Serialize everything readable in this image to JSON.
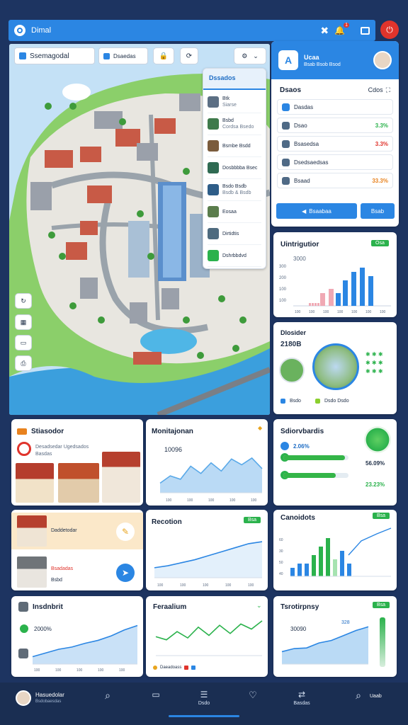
{
  "topbar": {
    "title": "Dimal",
    "badge_count": "1"
  },
  "toolbar": {
    "search_value": "Ssemagodal",
    "secondary_label": "Dsaedas"
  },
  "listing_popup": {
    "title": "Dssados",
    "items": [
      {
        "name": "Btk",
        "sub": "Siarse"
      },
      {
        "name": "Bsbd",
        "sub": "Cordsa Bsedo"
      },
      {
        "name": "Bsmbe Bsdd",
        "sub": ""
      },
      {
        "name": "Dosbbbba Bsec",
        "sub": ""
      },
      {
        "name": "Bsdo Bsdb",
        "sub": "Bsdb & Bsdb"
      },
      {
        "name": "Eosaa",
        "sub": ""
      },
      {
        "name": "Dirtidtis",
        "sub": ""
      },
      {
        "name": "Dshrbbdvd",
        "sub": ""
      }
    ]
  },
  "profile": {
    "name": "Ucaa",
    "sub": "Bsab Bsob Bsod"
  },
  "stats_list": {
    "title": "Dsaos",
    "side_label": "Cdos",
    "rows": [
      {
        "label": "Dasdas",
        "pct": ""
      },
      {
        "label": "Dsao",
        "pct": "3.3%"
      },
      {
        "label": "Bsasedsa",
        "pct": "3.3%"
      },
      {
        "label": "Dsedsaedsas",
        "pct": ""
      },
      {
        "label": "Bsaad",
        "pct": "33.3%"
      }
    ],
    "btn_primary": "Bsaabaa",
    "btn_secondary": "Bsab",
    "colors": {
      "green": "#2bb24c",
      "red": "#e0342c",
      "orange": "#e8821e"
    }
  },
  "uimrigutor": {
    "title": "Uintrigutior",
    "tag": "Osa",
    "y_value": "3000",
    "ticks": [
      "300",
      "200",
      "100",
      "100"
    ],
    "x_labels": [
      "100",
      "100",
      "100",
      "100",
      "100",
      "100",
      "100"
    ],
    "chart_data": {
      "type": "bar",
      "series": [
        {
          "name": "",
          "values": [
            1,
            1,
            1,
            1
          ]
        },
        {
          "name": "",
          "values": [
            3,
            4,
            3,
            6,
            8,
            9,
            7
          ]
        }
      ]
    }
  },
  "district": {
    "title": "Dlosider",
    "year": "2180B",
    "legend_a": "Bsdo",
    "legend_b": "Dsdo Dsdo"
  },
  "statistics_card": {
    "title": "Stiasodor",
    "sub": "Desadsedar Ugedsados",
    "caption": "Basdas"
  },
  "monitoring_card": {
    "title": "Monitajonan",
    "value": "10096",
    "axis": [
      "100",
      "100",
      "100",
      "100",
      "100"
    ],
    "chart_data": {
      "type": "area",
      "values": [
        20,
        35,
        28,
        55,
        40,
        62,
        45,
        70,
        58,
        72,
        50
      ]
    }
  },
  "satellite_card": {
    "title": "Sdiorvbardis",
    "pct1": "2.06%",
    "pct2": "56.09%",
    "pct3": "23.23%",
    "chart_data": {
      "type": "bar",
      "values": [
        0.95,
        0.8
      ]
    }
  },
  "residential_card": {
    "label": "Daddetodar",
    "label2": "Bsadadas",
    "label3": "Bsbd"
  },
  "reception_card": {
    "title": "Recotion",
    "tag": "Bsa",
    "axis": [
      "100",
      "100",
      "100",
      "100",
      "100"
    ],
    "chart_data": {
      "type": "line",
      "values": [
        10,
        12,
        15,
        18,
        22,
        26,
        30,
        34,
        36
      ]
    }
  },
  "economics_card": {
    "title": "Canoidots",
    "tag": "Bsa",
    "axis": [
      "60",
      "30",
      "50",
      "40"
    ],
    "chart_data": {
      "type": "bar",
      "values": [
        2,
        3,
        3,
        5,
        7,
        9,
        4,
        6,
        3
      ]
    }
  },
  "traffic_card": {
    "title": "Insdnbrit",
    "value": "2000%",
    "axis": [
      "100",
      "100",
      "100",
      "100",
      "100"
    ],
    "chart_data": {
      "type": "area",
      "values": [
        10,
        15,
        20,
        23,
        28,
        32,
        38,
        46,
        52
      ]
    }
  },
  "revenue_card": {
    "title": "Feraalium",
    "legend": "Daeadoass",
    "chart_data": {
      "type": "line",
      "values": [
        30,
        25,
        38,
        28,
        45,
        32,
        48,
        35,
        50,
        42,
        55
      ]
    }
  },
  "energy_card": {
    "title": "Tsrotirpnsy",
    "tag": "Bsa",
    "value": "30090",
    "v2": "328",
    "chart_data": {
      "type": "area",
      "values": [
        20,
        25,
        26,
        34,
        38,
        46,
        54,
        60
      ]
    }
  },
  "bottom_nav": {
    "user_name": "Hasuedolar",
    "user_sub": "Bsdobaesdas",
    "items": [
      "",
      "",
      "Dsdo",
      "",
      "Basdas",
      "Uaab"
    ]
  }
}
